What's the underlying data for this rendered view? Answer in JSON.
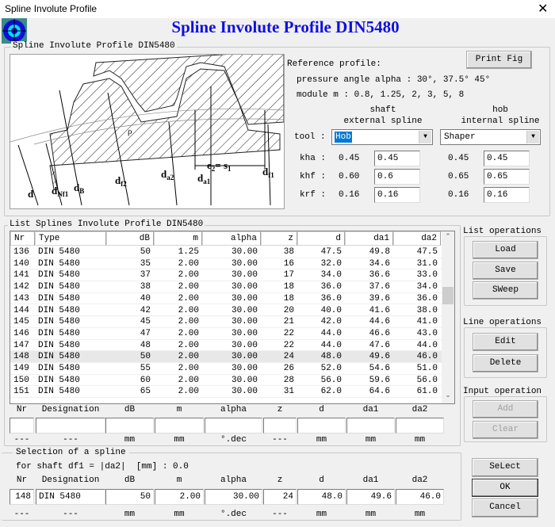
{
  "window": {
    "title": "Spline Involute Profile",
    "close": "✕",
    "heading": "Spline Involute Profile DIN5480"
  },
  "profile_group": {
    "legend": "Spline Involute Profile DIN5480",
    "figure_labels": {
      "d": "d",
      "dNf1": "d",
      "dNf1_sub": "Nf1",
      "dB": "d",
      "dB_sub": "B",
      "df2": "d",
      "df2_sub": "f2",
      "da2": "d",
      "da2_sub": "a2",
      "da1": "d",
      "da1_sub": "a1",
      "df1": "d",
      "df1_sub": "f1",
      "e2s1": "e",
      "e2s1_sub": "2",
      "e2s1_eq": "= s",
      "e2s1_sub2": "1",
      "rho": "ρ"
    },
    "print_fig": "Print Fig",
    "reference": "Reference profile:",
    "pressure_angle": "pressure angle alpha : 30°, 37.5° 45°",
    "module": "module m : 0.8, 1.25, 2, 3, 5, 8",
    "shaft_h1": "shaft",
    "shaft_h2": "external spline",
    "hob_h1": "hob",
    "hob_h2": "internal spline",
    "tool_label": "tool :",
    "shaft_tool": "Hob",
    "hob_tool": "Shaper",
    "params": [
      {
        "label": "kha :",
        "shaft_default": "0.45",
        "shaft_value": "0.45",
        "hob_default": "0.45",
        "hob_value": "0.45"
      },
      {
        "label": "khf :",
        "shaft_default": "0.60",
        "shaft_value": "0.6",
        "hob_default": "0.65",
        "hob_value": "0.65"
      },
      {
        "label": "krf :",
        "shaft_default": "0.16",
        "shaft_value": "0.16",
        "hob_default": "0.16",
        "hob_value": "0.16"
      }
    ]
  },
  "list_group": {
    "legend": "List Splines Involute Profile DIN5480",
    "columns": [
      "Nr",
      "Type",
      "dB",
      "m",
      "alpha",
      "z",
      "d",
      "da1",
      "da2"
    ],
    "selected_nr": "148",
    "rows": [
      [
        "136",
        "DIN 5480",
        "50",
        "1.25",
        "30.00",
        "38",
        "47.5",
        "49.8",
        "47.5"
      ],
      [
        "140",
        "DIN 5480",
        "35",
        "2.00",
        "30.00",
        "16",
        "32.0",
        "34.6",
        "31.0"
      ],
      [
        "141",
        "DIN 5480",
        "37",
        "2.00",
        "30.00",
        "17",
        "34.0",
        "36.6",
        "33.0"
      ],
      [
        "142",
        "DIN 5480",
        "38",
        "2.00",
        "30.00",
        "18",
        "36.0",
        "37.6",
        "34.0"
      ],
      [
        "143",
        "DIN 5480",
        "40",
        "2.00",
        "30.00",
        "18",
        "36.0",
        "39.6",
        "36.0"
      ],
      [
        "144",
        "DIN 5480",
        "42",
        "2.00",
        "30.00",
        "20",
        "40.0",
        "41.6",
        "38.0"
      ],
      [
        "145",
        "DIN 5480",
        "45",
        "2.00",
        "30.00",
        "21",
        "42.0",
        "44.6",
        "41.0"
      ],
      [
        "146",
        "DIN 5480",
        "47",
        "2.00",
        "30.00",
        "22",
        "44.0",
        "46.6",
        "43.0"
      ],
      [
        "147",
        "DIN 5480",
        "48",
        "2.00",
        "30.00",
        "22",
        "44.0",
        "47.6",
        "44.0"
      ],
      [
        "148",
        "DIN 5480",
        "50",
        "2.00",
        "30.00",
        "24",
        "48.0",
        "49.6",
        "46.0"
      ],
      [
        "149",
        "DIN 5480",
        "55",
        "2.00",
        "30.00",
        "26",
        "52.0",
        "54.6",
        "51.0"
      ],
      [
        "150",
        "DIN 5480",
        "60",
        "2.00",
        "30.00",
        "28",
        "56.0",
        "59.6",
        "56.0"
      ],
      [
        "151",
        "DIN 5480",
        "65",
        "2.00",
        "30.00",
        "31",
        "62.0",
        "64.6",
        "61.0"
      ]
    ],
    "input_labels": [
      "Nr",
      "Designation",
      "dB",
      "m",
      "alpha",
      "z",
      "d",
      "da1",
      "da2"
    ],
    "input_values": [
      "",
      "",
      "",
      "",
      "",
      "",
      "",
      "",
      ""
    ],
    "units": [
      "---",
      "---",
      "mm",
      "mm",
      "°.dec",
      "---",
      "mm",
      "mm",
      "mm"
    ]
  },
  "list_ops": {
    "legend": "List operations",
    "load": "Load",
    "save": "Save",
    "sweep": "SWeep"
  },
  "line_ops": {
    "legend": "Line operations",
    "edit": "Edit",
    "delete": "Delete"
  },
  "input_ops": {
    "legend": "Input operation",
    "add": "Add",
    "clear": "Clear"
  },
  "selection": {
    "legend": "Selection of a spline",
    "info": "for shaft df1 = |da2|  [mm] : 0.0",
    "labels": [
      "Nr",
      "Designation",
      "dB",
      "m",
      "alpha",
      "z",
      "d",
      "da1",
      "da2"
    ],
    "values": [
      "148",
      "DIN 5480",
      "50",
      "2.00",
      "30.00",
      "24",
      "48.0",
      "49.6",
      "46.0"
    ],
    "units": [
      "---",
      "---",
      "mm",
      "mm",
      "°.dec",
      "---",
      "mm",
      "mm",
      "mm"
    ],
    "select": "SeLect",
    "ok": "OK",
    "cancel": "Cancel"
  }
}
